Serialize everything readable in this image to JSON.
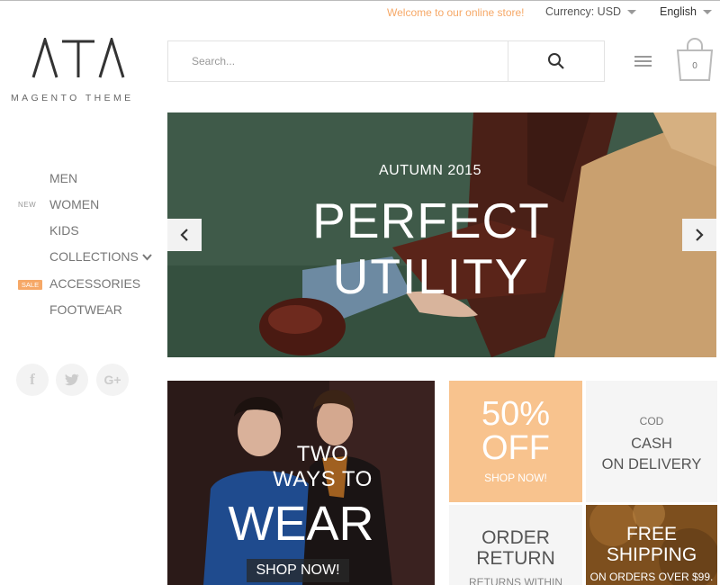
{
  "topbar": {
    "welcome": "Welcome to our online store!",
    "currency_label": "Currency:",
    "currency_value": "USD",
    "language": "English"
  },
  "logo": {
    "mark": "ATA",
    "tagline": "MAGENTO THEME"
  },
  "search": {
    "placeholder": "Search..."
  },
  "cart": {
    "count": "0"
  },
  "nav": {
    "items": [
      {
        "label": "MEN"
      },
      {
        "label": "WOMEN",
        "badge": "NEW"
      },
      {
        "label": "KIDS"
      },
      {
        "label": "COLLECTIONS"
      },
      {
        "label": "ACCESSORIES",
        "badge": "SALE"
      },
      {
        "label": "FOOTWEAR"
      }
    ]
  },
  "social": {
    "facebook": "f",
    "googleplus": "G+"
  },
  "hero": {
    "subtitle": "AUTUMN 2015",
    "title_line1": "PERFECT",
    "title_line2": "UTILITY"
  },
  "promo_wear": {
    "line1": "TWO",
    "line2": "WAYS TO",
    "big": "WEAR",
    "button": "SHOP NOW!"
  },
  "promo_sale": {
    "percent": "50%",
    "off": "OFF",
    "button": "SHOP NOW!"
  },
  "promo_cod": {
    "small": "COD",
    "line1": "CASH",
    "line2": "ON DELIVERY"
  },
  "promo_return": {
    "line1": "ORDER",
    "line2": "RETURN",
    "sub": "RETURNS WITHIN"
  },
  "promo_shipping": {
    "line1": "FREE",
    "line2": "SHIPPING",
    "sub": "ON ORDERS OVER $99."
  },
  "colors": {
    "accent": "#f6a867",
    "peach_tile": "#f8c38e",
    "hero_green": "#3e5747"
  }
}
